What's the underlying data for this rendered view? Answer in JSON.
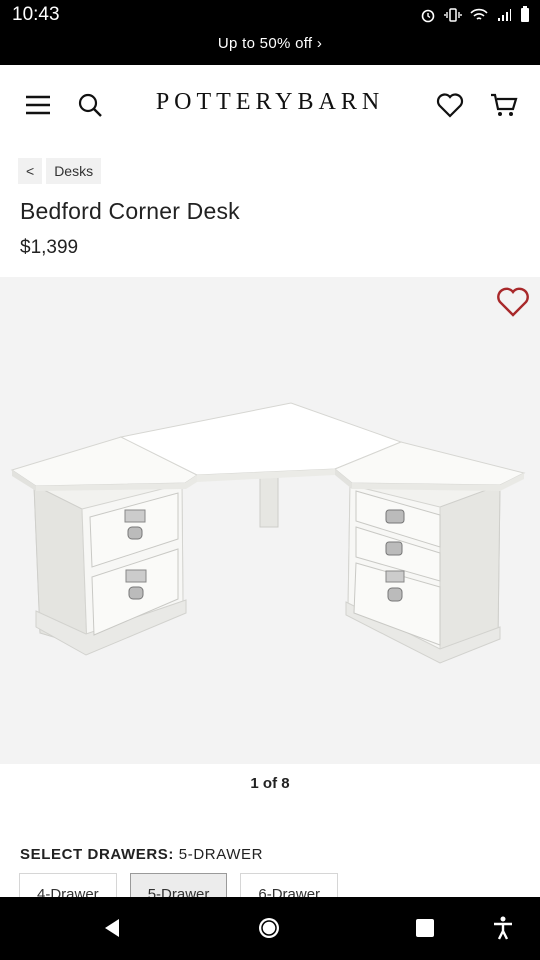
{
  "status_bar": {
    "time": "10:43",
    "icons": [
      "alarm-icon",
      "vibrate-icon",
      "wifi-icon",
      "signal-icon",
      "battery-icon"
    ]
  },
  "promo": {
    "text": "Up to 50% off ›"
  },
  "header": {
    "brand": "POTTERYBARN",
    "icons": [
      "menu-icon",
      "search-icon",
      "heart-icon",
      "cart-icon"
    ]
  },
  "breadcrumb": {
    "back": "<",
    "category": "Desks"
  },
  "product": {
    "title": "Bedford Corner Desk",
    "price": "$1,399"
  },
  "gallery": {
    "pager": "1 of 8",
    "accent_color": "#a8282a"
  },
  "options": {
    "label": "SELECT DRAWERS:",
    "selected_value": "5-DRAWER",
    "drawers": [
      "4-Drawer",
      "5-Drawer",
      "6-Drawer"
    ],
    "selected_index": 1
  },
  "nav": {
    "icons": [
      "back-icon",
      "home-icon",
      "recents-icon",
      "accessibility-icon"
    ]
  }
}
